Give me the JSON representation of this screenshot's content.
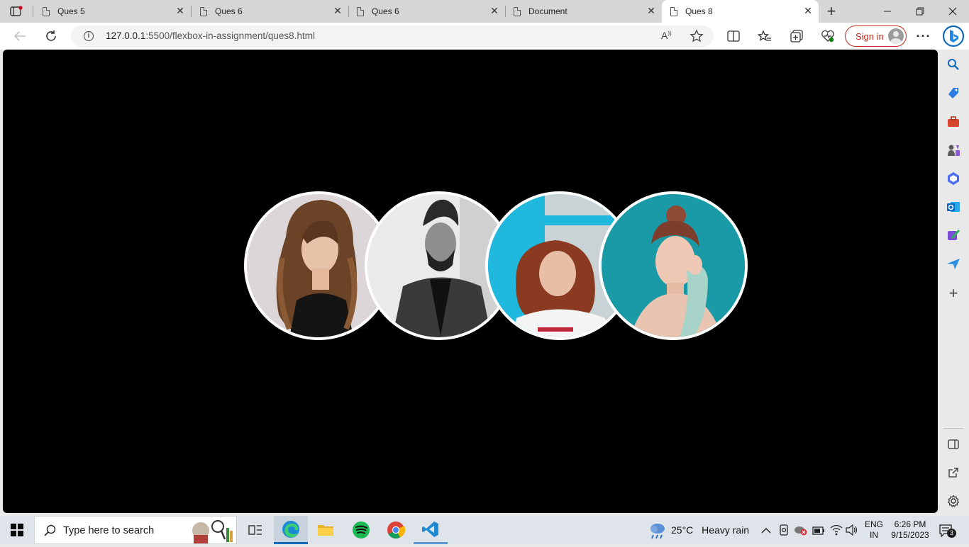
{
  "browser": {
    "tabs": [
      {
        "title": "Ques 5",
        "active": false
      },
      {
        "title": "Ques 6",
        "active": false
      },
      {
        "title": "Ques 6",
        "active": false
      },
      {
        "title": "Document",
        "active": false
      },
      {
        "title": "Ques 8",
        "active": true
      }
    ],
    "url_host": "127.0.0.1",
    "url_rest": ":5500/flexbox-in-assignment/ques8.html",
    "signin_label": "Sign in"
  },
  "page": {
    "background": "#000000",
    "photos": [
      {
        "alt": "woman-portrait-1"
      },
      {
        "alt": "man-portrait"
      },
      {
        "alt": "woman-portrait-2"
      },
      {
        "alt": "woman-portrait-3"
      }
    ]
  },
  "taskbar": {
    "search_placeholder": "Type here to search",
    "weather": {
      "temp": "25°C",
      "condition": "Heavy rain"
    },
    "lang_top": "ENG",
    "lang_bottom": "IN",
    "time": "6:26 PM",
    "date": "9/15/2023",
    "notification_count": "3"
  },
  "colors": {
    "accent_red": "#c42b1c",
    "edge_blue": "#0f6cbd"
  }
}
